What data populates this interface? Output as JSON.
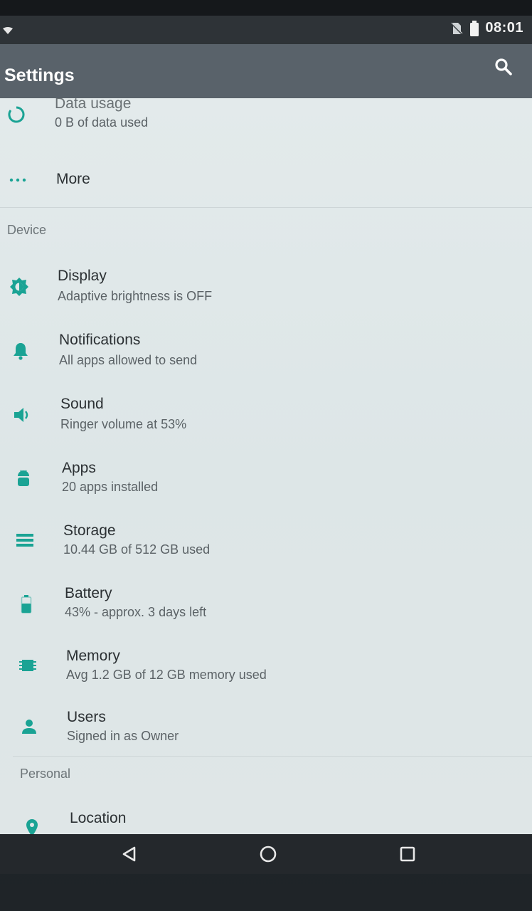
{
  "status_bar": {
    "time": "08:01"
  },
  "app_bar": {
    "title": "Settings"
  },
  "wireless": {
    "data_usage": {
      "title": "Data usage",
      "subtitle": "0 B of data used"
    },
    "more": {
      "title": "More"
    }
  },
  "device": {
    "header": "Device",
    "items": [
      {
        "title": "Display",
        "subtitle": "Adaptive brightness is OFF"
      },
      {
        "title": "Notifications",
        "subtitle": "All apps allowed to send"
      },
      {
        "title": "Sound",
        "subtitle": "Ringer volume at 53%"
      },
      {
        "title": "Apps",
        "subtitle": "20 apps installed"
      },
      {
        "title": "Storage",
        "subtitle": "10.44 GB of 512 GB used"
      },
      {
        "title": "Battery",
        "subtitle": "43% - approx. 3 days left"
      },
      {
        "title": "Memory",
        "subtitle": "Avg 1.2 GB of 12 GB memory used"
      },
      {
        "title": "Users",
        "subtitle": "Signed in as Owner"
      }
    ]
  },
  "personal": {
    "header": "Personal",
    "items": [
      {
        "title": "Location"
      }
    ]
  },
  "colors": {
    "accent": "#1aa394",
    "app_bar": "#59626a",
    "status_bar": "#2e3337"
  }
}
